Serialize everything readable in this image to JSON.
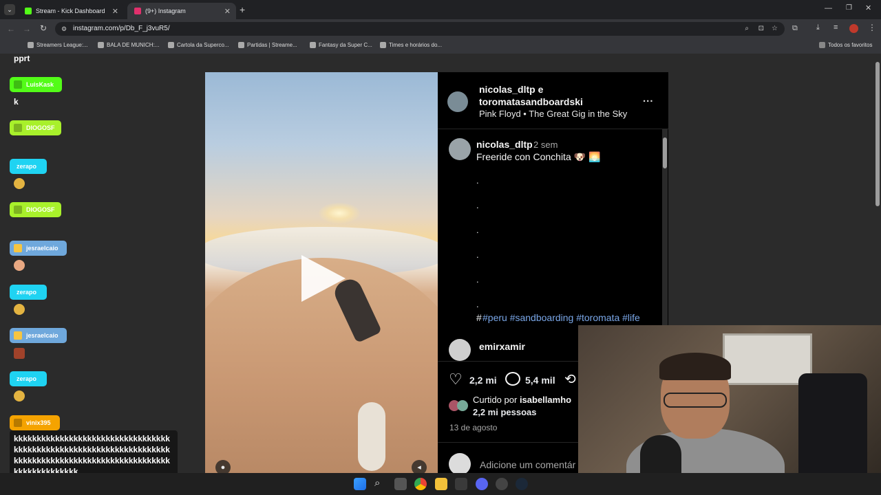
{
  "browser": {
    "tabs": [
      {
        "label": "Stream - Kick Dashboard",
        "active": false,
        "favicon_color": "#53fc18"
      },
      {
        "label": "(9+) Instagram",
        "active": true,
        "favicon_color": "#e1306c"
      }
    ],
    "new_tab": "+",
    "url": "instagram.com/p/Db_F_j3vuR5/",
    "bookmarks": [
      "Streamers League:...",
      "BALA DE MUNICH:...",
      "Cartola da Superco...",
      "Partidas | Streame...",
      "Fantasy da Super C...",
      "Times e horários do..."
    ],
    "all_bookmarks": "Todos os favoritos"
  },
  "post": {
    "header": {
      "line1": "nicolas_dltp e",
      "line2": "toromatasandboardski",
      "audio": "Pink Floyd • The Great Gig in the Sky",
      "more": "..."
    },
    "caption": {
      "username": "nicolas_dltp",
      "time": "2 sem",
      "text": "Freeride con Conchita 🐶 🌅",
      "dots": [
        ".",
        ".",
        ".",
        ".",
        ".",
        "."
      ],
      "hash": "#",
      "tags": "#peru #sandboarding #toromata #life"
    },
    "comment": {
      "username": "emirxamir"
    },
    "actions": {
      "likes": "2,2 mi",
      "comments": "5,4 mil"
    },
    "liked_by": {
      "prefix": "Curtido por",
      "user": "isabellamho",
      "count": "2,2 mi pessoas"
    },
    "date": "13 de agosto",
    "add_comment": "Adicione um comentár"
  },
  "chat": {
    "top_label": "pprt",
    "k_label": "k",
    "chips": [
      {
        "name": "LuisKask",
        "color": "#53fc18"
      },
      {
        "name": "DIOGOSF",
        "color": "#a8f02b"
      },
      {
        "name": "zerapo",
        "color": "#1fd3f2"
      },
      {
        "name": "DIOGOSF",
        "color": "#a8f02b"
      },
      {
        "name": "jesraelcaio",
        "color": "#6fa8dc"
      },
      {
        "name": "zerapo",
        "color": "#1fd3f2"
      },
      {
        "name": "jesraelcaio",
        "color": "#6fa8dc"
      },
      {
        "name": "zerapo",
        "color": "#1fd3f2"
      },
      {
        "name": "vinix395",
        "color": "#f5a300"
      }
    ],
    "message": "kkkkkkkkkkkkkkkkkkkkkkkkkkkkkkkkkkkkkkkkkkkkkkkkkkkkkkkkkkkkkkkkkkkkkkkkkkkkkkkkkkkkkkkkkkkkkkkkkkkkkkkkkkkkkkkkkkkk"
  }
}
